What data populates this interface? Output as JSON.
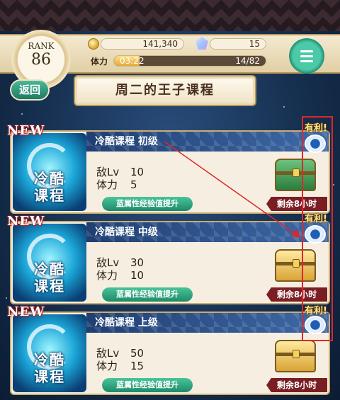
{
  "header": {
    "rank_label": "RANK",
    "rank_value": "86",
    "coins": "141,340",
    "gems": "15",
    "stamina_label": "体力",
    "stamina_timer": "03:22",
    "stamina_count": "14/82",
    "stamina_fill_fraction": 0.17
  },
  "nav": {
    "back_label": "返回",
    "page_title": "周二的王子课程"
  },
  "courses": [
    {
      "new_badge": "NEW",
      "orb_label_1": "冷酷",
      "orb_label_2": "课程",
      "name": "冷酷课程 初级",
      "enemy_lv_label": "敌Lv",
      "enemy_lv": "10",
      "stamina_label": "体力",
      "stamina_cost": "5",
      "bonus": "蓝属性经验值提升",
      "reward_chest": "green-chest-icon",
      "time_left": "剩余8小时",
      "advantage": "有利!"
    },
    {
      "new_badge": "NEW",
      "orb_label_1": "冷酷",
      "orb_label_2": "课程",
      "name": "冷酷课程 中级",
      "enemy_lv_label": "敌Lv",
      "enemy_lv": "30",
      "stamina_label": "体力",
      "stamina_cost": "10",
      "bonus": "蓝属性经验值提升",
      "reward_chest": "gold-chest-icon",
      "time_left": "剩余8小时",
      "advantage": "有利!"
    },
    {
      "new_badge": "NEW",
      "orb_label_1": "冷酷",
      "orb_label_2": "课程",
      "name": "冷酷课程 上级",
      "enemy_lv_label": "敌Lv",
      "enemy_lv": "50",
      "stamina_label": "体力",
      "stamina_cost": "15",
      "bonus": "蓝属性经验值提升",
      "reward_chest": "gold-chest-icon",
      "time_left": "剩余8小时",
      "advantage": "有利!"
    }
  ],
  "colors": {
    "annotation_red": "#e0262a",
    "banner_blue": "#1f3f73",
    "bonus_green": "#1e8a68"
  }
}
